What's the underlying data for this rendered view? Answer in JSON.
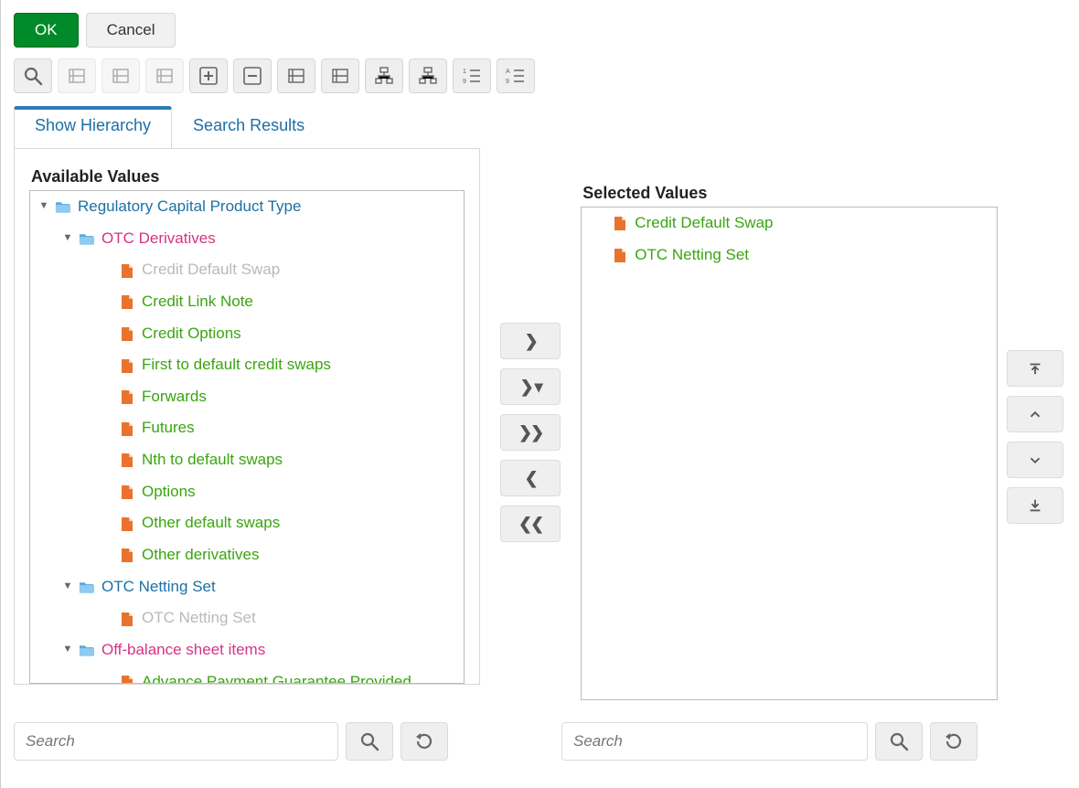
{
  "buttons": {
    "ok": "OK",
    "cancel": "Cancel"
  },
  "tabs": {
    "show_hierarchy": "Show Hierarchy",
    "search_results": "Search Results",
    "active": "show_hierarchy"
  },
  "headings": {
    "available": "Available Values",
    "selected": "Selected Values"
  },
  "search": {
    "placeholder_left": "Search",
    "placeholder_right": "Search"
  },
  "toolbar_icons": [
    "search-preview-icon",
    "align-center-lock-icon",
    "align-left-lock-icon",
    "align-spread-icon",
    "expand-plus-icon",
    "collapse-minus-icon",
    "node-add-right-icon",
    "node-add-child-icon",
    "tree-flat-icon",
    "tree-nested-icon",
    "list-numbered-icon",
    "list-alpha-icon"
  ],
  "tree": [
    {
      "depth": 0,
      "type": "folder",
      "expanded": true,
      "label": "Regulatory Capital Product Type",
      "color": "blue"
    },
    {
      "depth": 1,
      "type": "folder",
      "expanded": true,
      "label": "OTC Derivatives",
      "color": "magenta"
    },
    {
      "depth": 2,
      "type": "file",
      "label": "Credit Default Swap",
      "color": "grey"
    },
    {
      "depth": 2,
      "type": "file",
      "label": "Credit Link Note",
      "color": "green"
    },
    {
      "depth": 2,
      "type": "file",
      "label": "Credit Options",
      "color": "green"
    },
    {
      "depth": 2,
      "type": "file",
      "label": "First to default credit swaps",
      "color": "green"
    },
    {
      "depth": 2,
      "type": "file",
      "label": "Forwards",
      "color": "green"
    },
    {
      "depth": 2,
      "type": "file",
      "label": "Futures",
      "color": "green"
    },
    {
      "depth": 2,
      "type": "file",
      "label": "Nth to default swaps",
      "color": "green"
    },
    {
      "depth": 2,
      "type": "file",
      "label": "Options",
      "color": "green"
    },
    {
      "depth": 2,
      "type": "file",
      "label": "Other default swaps",
      "color": "green"
    },
    {
      "depth": 2,
      "type": "file",
      "label": "Other derivatives",
      "color": "green"
    },
    {
      "depth": 1,
      "type": "folder",
      "expanded": true,
      "label": "OTC Netting Set",
      "color": "blue"
    },
    {
      "depth": 2,
      "type": "file",
      "label": "OTC Netting Set",
      "color": "grey"
    },
    {
      "depth": 1,
      "type": "folder",
      "expanded": true,
      "label": "Off-balance sheet items",
      "color": "magenta"
    },
    {
      "depth": 2,
      "type": "file",
      "label": "Advance Payment Guarantee Provided",
      "color": "green"
    }
  ],
  "selected": [
    {
      "label": "Credit Default Swap"
    },
    {
      "label": "OTC Netting Set"
    }
  ],
  "transfer_icons": [
    "move-right-icon",
    "move-right-dropdown-icon",
    "move-all-right-icon",
    "move-left-icon",
    "move-all-left-icon"
  ],
  "reorder_icons": [
    "move-top-icon",
    "move-up-icon",
    "move-down-icon",
    "move-bottom-icon"
  ]
}
